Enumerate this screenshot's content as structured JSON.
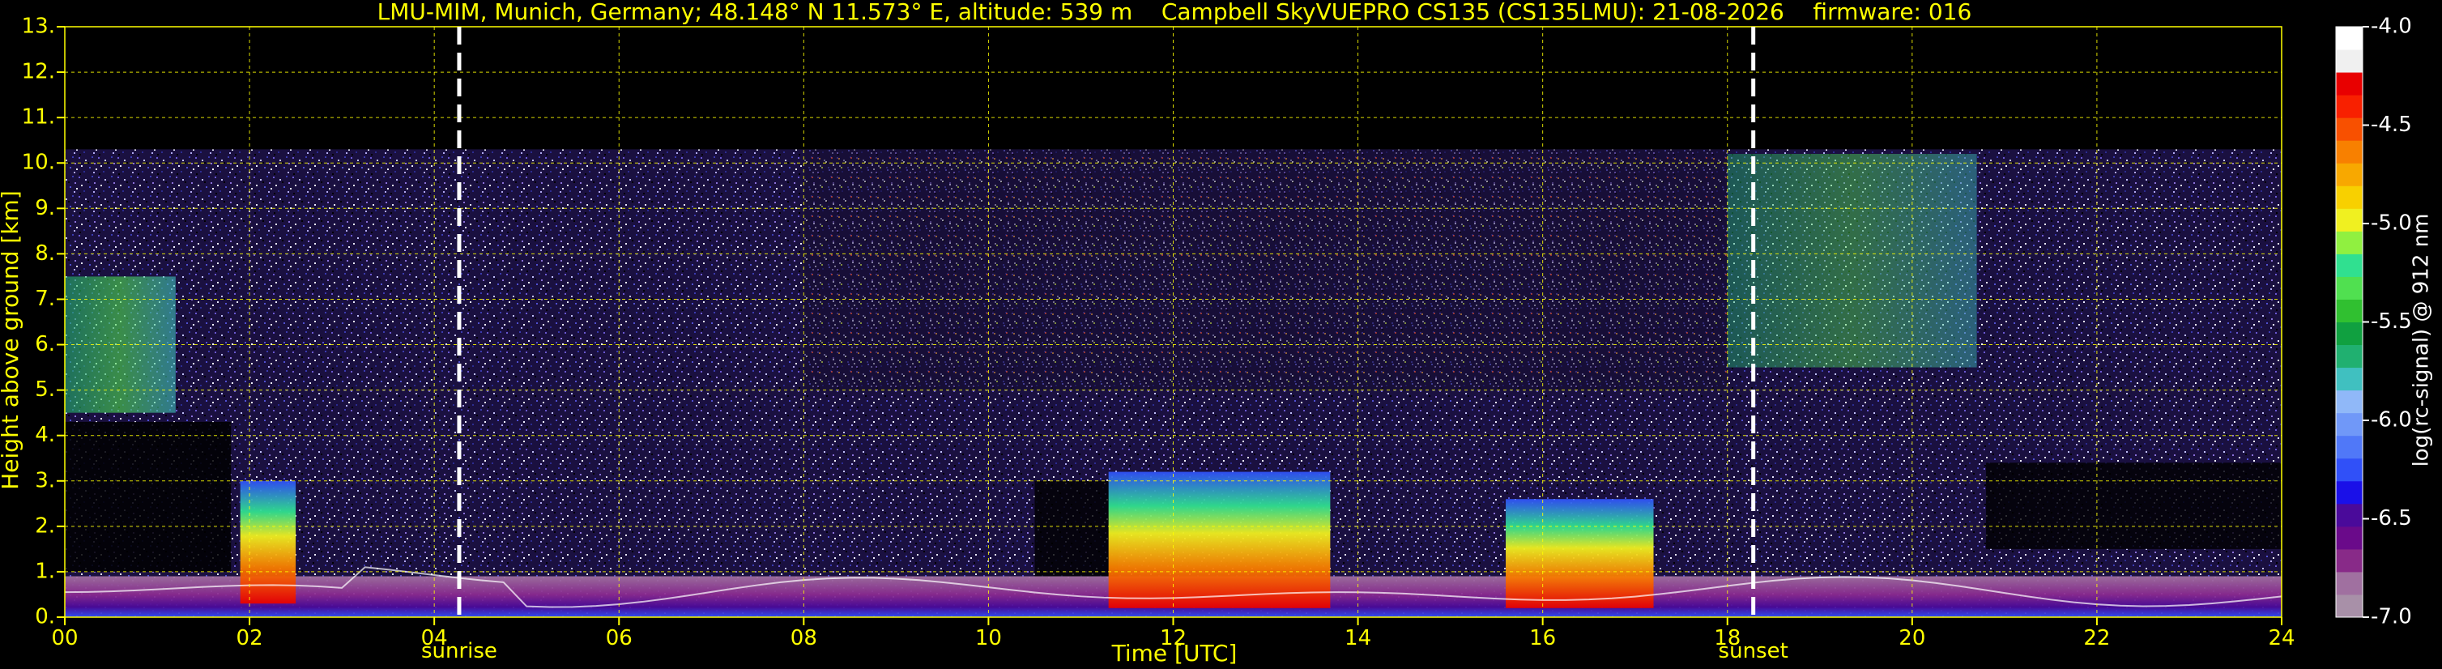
{
  "title": "LMU-MIM, Munich, Germany; 48.148° N 11.573° E, altitude: 539 m    Campbell SkyVUEPRO CS135 (CS135LMU): 21-08-2026    firmware: 016",
  "colors": {
    "background": "#000000",
    "text": "#ffff00",
    "grid": "#ffff00",
    "marker_lines": "#ffffff"
  },
  "chart_data": {
    "type": "heatmap",
    "title": "LMU-MIM, Munich, Germany; 48.148° N 11.573° E, altitude: 539 m    Campbell SkyVUEPRO CS135 (CS135LMU): 21-08-2026    firmware: 016",
    "xlabel": "Time [UTC]",
    "ylabel": "Height above ground [km]",
    "xlim": [
      0,
      24
    ],
    "ylim": [
      0,
      13
    ],
    "x_ticks": [
      0,
      2,
      4,
      6,
      8,
      10,
      12,
      14,
      16,
      18,
      20,
      22,
      24
    ],
    "x_tick_labels": [
      "00",
      "02",
      "04",
      "06",
      "08",
      "10",
      "12",
      "14",
      "16",
      "18",
      "20",
      "22",
      "24"
    ],
    "y_ticks": [
      0,
      1,
      2,
      3,
      4,
      5,
      6,
      7,
      8,
      9,
      10,
      11,
      12,
      13
    ],
    "y_tick_labels": [
      "0.",
      "1.",
      "2.",
      "3.",
      "4.",
      "5.",
      "6.",
      "7.",
      "8.",
      "9.",
      "10.",
      "11.",
      "12.",
      "13."
    ],
    "grid": true,
    "data_top_km": 10.3,
    "markers": [
      {
        "label": "sunrise",
        "time_utc": 4.27
      },
      {
        "label": "sunset",
        "time_utc": 18.28
      }
    ],
    "colorbar": {
      "label": "log(rc-signal) @ 912 nm",
      "range": [
        -7.0,
        -4.0
      ],
      "ticks": [
        -4.0,
        -4.5,
        -5.0,
        -5.5,
        -6.0,
        -6.5,
        -7.0
      ],
      "tick_labels": [
        "-4.0",
        "-4.5",
        "-5.0",
        "-5.5",
        "-6.0",
        "-6.5",
        "-7.0"
      ],
      "colors": [
        "#a890a8",
        "#a070a0",
        "#882a88",
        "#6a0a8a",
        "#4a0a9a",
        "#1a10e8",
        "#3050f8",
        "#5078f8",
        "#7098f8",
        "#90b8f8",
        "#40c0c0",
        "#20b070",
        "#10a040",
        "#30c030",
        "#50e050",
        "#30e090",
        "#90f040",
        "#f0f020",
        "#f8d000",
        "#f8a800",
        "#f88000",
        "#f85000",
        "#f82000",
        "#e80000",
        "#f0f0f0",
        "#ffffff"
      ]
    },
    "features": [
      {
        "name": "boundary layer aerosol",
        "t_start": 0.0,
        "t_end": 24.0,
        "z_bottom": 0.0,
        "z_top": 0.9
      },
      {
        "name": "cloud layer (morning)",
        "t_start": 1.9,
        "t_end": 2.5,
        "z_bottom": 0.3,
        "z_top": 3.0
      },
      {
        "name": "convective clouds",
        "t_start": 11.3,
        "t_end": 13.7,
        "z_bottom": 0.2,
        "z_top": 3.2
      },
      {
        "name": "convective clouds",
        "t_start": 15.6,
        "t_end": 17.2,
        "z_bottom": 0.2,
        "z_top": 2.6
      },
      {
        "name": "upper-level cloud",
        "t_start": 0.0,
        "t_end": 1.2,
        "z_bottom": 4.5,
        "z_top": 7.5
      },
      {
        "name": "high cloud after sunset",
        "t_start": 18.0,
        "t_end": 20.7,
        "z_bottom": 5.5,
        "z_top": 10.2
      }
    ]
  }
}
